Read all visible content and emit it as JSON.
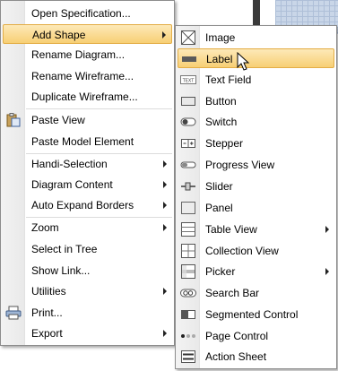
{
  "main_menu": {
    "items": [
      {
        "label": "Open Specification..."
      },
      {
        "label": "Add Shape"
      },
      {
        "label": "Rename Diagram..."
      },
      {
        "label": "Rename Wireframe..."
      },
      {
        "label": "Duplicate Wireframe..."
      },
      {
        "label": "Paste View"
      },
      {
        "label": "Paste Model Element"
      },
      {
        "label": "Handi-Selection"
      },
      {
        "label": "Diagram Content"
      },
      {
        "label": "Auto Expand Borders"
      },
      {
        "label": "Zoom"
      },
      {
        "label": "Select in Tree"
      },
      {
        "label": "Show Link..."
      },
      {
        "label": "Utilities"
      },
      {
        "label": "Print..."
      },
      {
        "label": "Export"
      }
    ]
  },
  "sub_menu": {
    "items": [
      {
        "label": "Image"
      },
      {
        "label": "Label"
      },
      {
        "label": "Text Field"
      },
      {
        "label": "Button"
      },
      {
        "label": "Switch"
      },
      {
        "label": "Stepper"
      },
      {
        "label": "Progress View"
      },
      {
        "label": "Slider"
      },
      {
        "label": "Panel"
      },
      {
        "label": "Table View"
      },
      {
        "label": "Collection View"
      },
      {
        "label": "Picker"
      },
      {
        "label": "Search Bar"
      },
      {
        "label": "Segmented Control"
      },
      {
        "label": "Page Control"
      },
      {
        "label": "Action Sheet"
      }
    ]
  },
  "icons": {
    "text_field_icon_text": "TEXT"
  },
  "colors": {
    "highlight": "#f7cf74",
    "highlight_border": "#e3ad45"
  }
}
